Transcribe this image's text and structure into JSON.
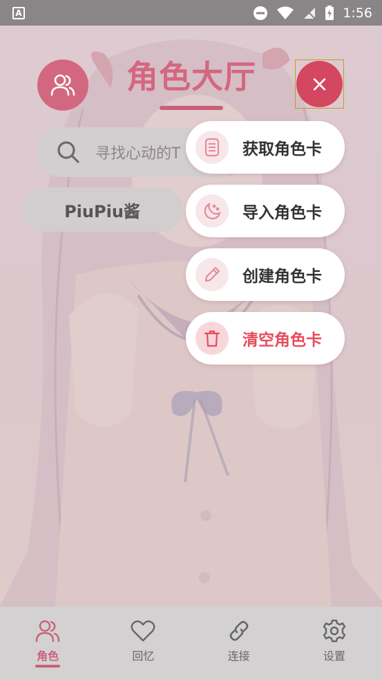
{
  "status_bar": {
    "time": "1:56"
  },
  "header": {
    "title": "角色大厅",
    "close_symbol": "×"
  },
  "search": {
    "placeholder": "寻找心动的T"
  },
  "character": {
    "name": "PiuPiu酱"
  },
  "menu": {
    "items": [
      {
        "label": "获取角色卡",
        "icon": "card-stack-icon",
        "danger": false
      },
      {
        "label": "导入角色卡",
        "icon": "moon-icon",
        "danger": false
      },
      {
        "label": "创建角色卡",
        "icon": "pencil-icon",
        "danger": false
      },
      {
        "label": "清空角色卡",
        "icon": "trash-icon",
        "danger": true
      }
    ]
  },
  "bottom_nav": {
    "items": [
      {
        "label": "角色",
        "icon": "users-icon",
        "active": true
      },
      {
        "label": "回忆",
        "icon": "heart-icon",
        "active": false
      },
      {
        "label": "连接",
        "icon": "link-icon",
        "active": false
      },
      {
        "label": "设置",
        "icon": "gear-icon",
        "active": false
      }
    ]
  },
  "colors": {
    "accent": "#d46780",
    "close": "#d44760",
    "danger": "#e74b5d"
  }
}
